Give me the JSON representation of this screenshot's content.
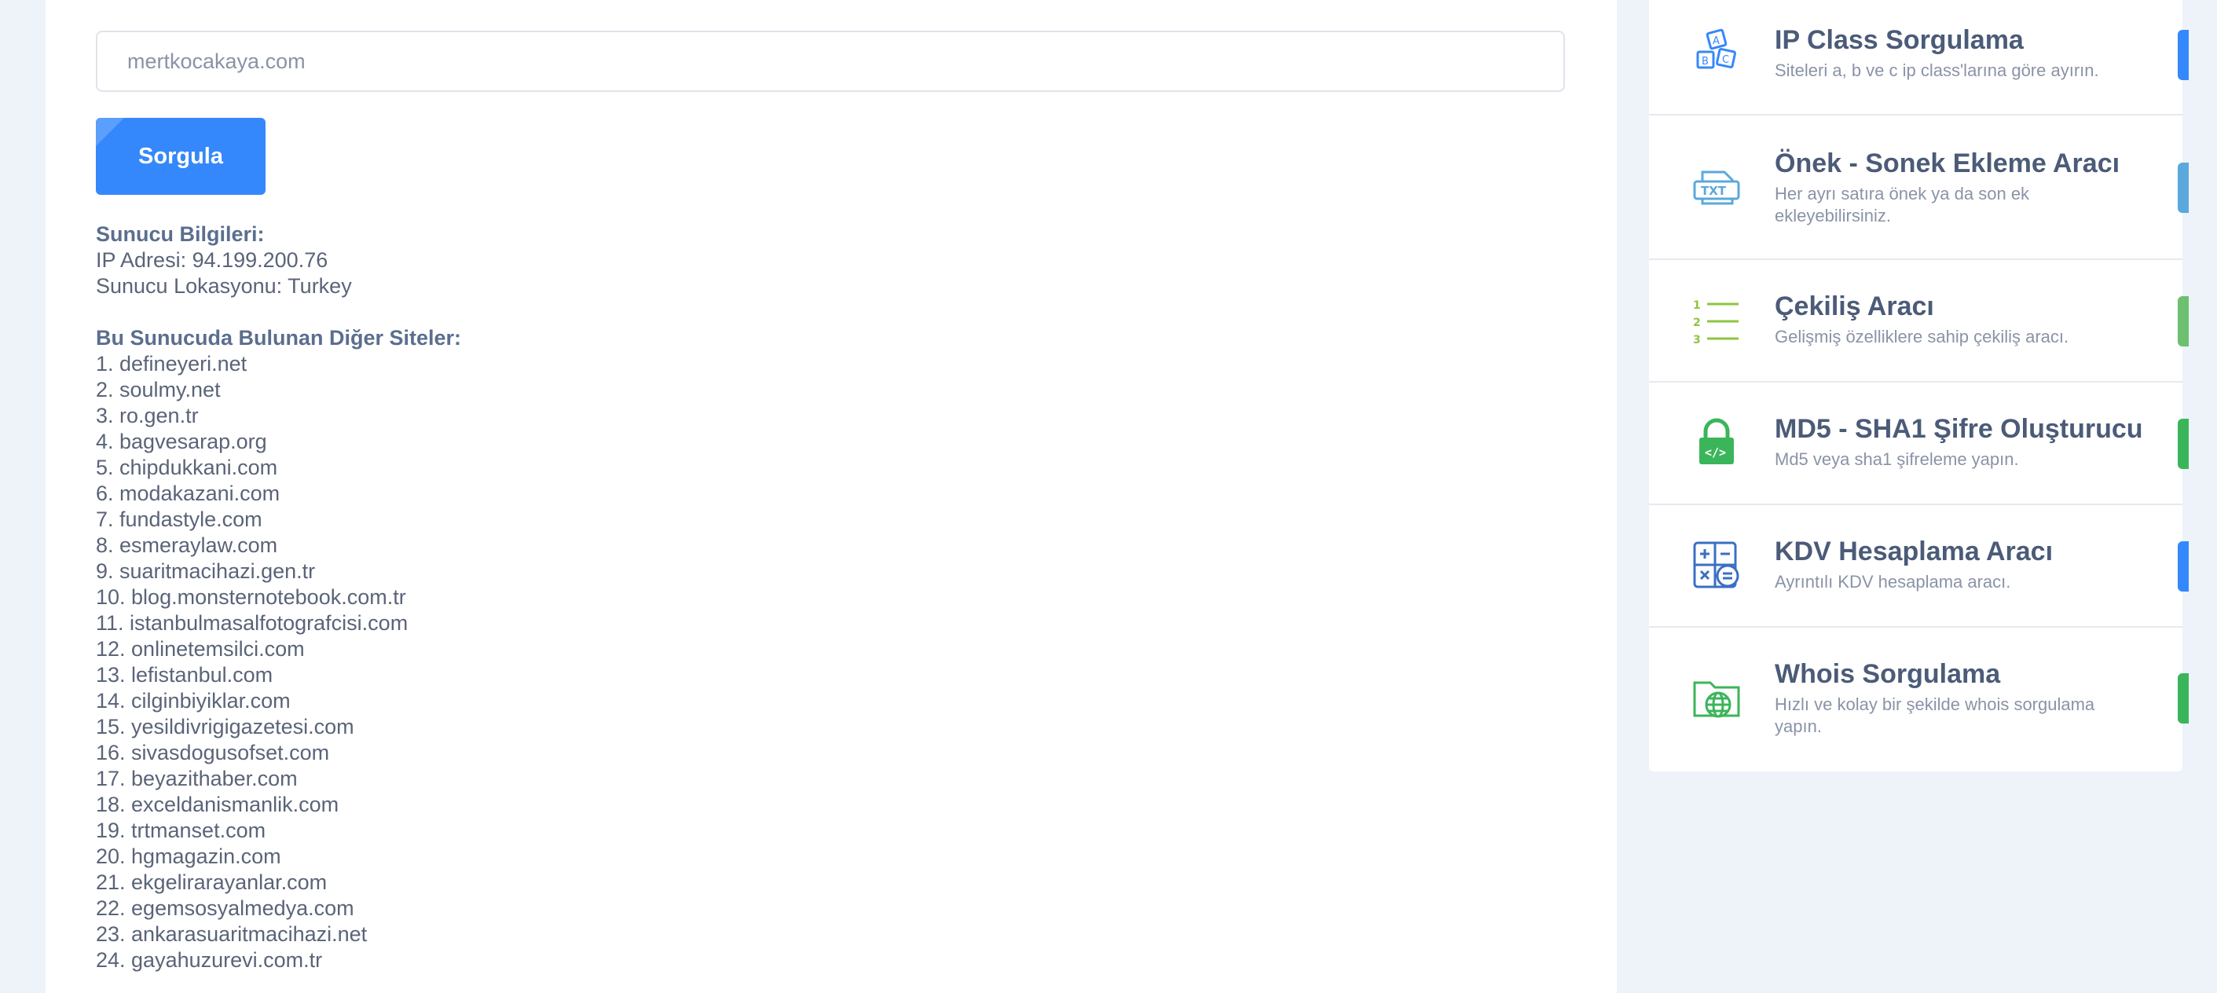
{
  "query": {
    "input_value": "mertkocakaya.com",
    "button_label": "Sorgula"
  },
  "server_info": {
    "heading": "Sunucu Bilgileri:",
    "ip_line": "IP Adresi: 94.199.200.76",
    "location_line": "Sunucu Lokasyonu: Turkey"
  },
  "other_sites": {
    "heading": "Bu Sunucuda Bulunan Diğer Siteler:",
    "items": [
      "1. defineyeri.net",
      "2. soulmy.net",
      "3. ro.gen.tr",
      "4. bagvesarap.org",
      "5. chipdukkani.com",
      "6. modakazani.com",
      "7. fundastyle.com",
      "8. esmeraylaw.com",
      "9. suaritmacihazi.gen.tr",
      "10. blog.monsternotebook.com.tr",
      "11. istanbulmasalfotografcisi.com",
      "12. onlinetemsilci.com",
      "13. lefistanbul.com",
      "14. cilginbiyiklar.com",
      "15. yesildivrigigazetesi.com",
      "16. sivasdogusofset.com",
      "17. beyazithaber.com",
      "18. exceldanismanlik.com",
      "19. trtmanset.com",
      "20. hgmagazin.com",
      "21. ekgelirarayanlar.com",
      "22. egemsosyalmedya.com",
      "23. ankarasuaritmacihazi.net",
      "24. gayahuzurevi.com.tr"
    ]
  },
  "sidebar": {
    "tools": [
      {
        "title": "IP Class Sorgulama",
        "desc": "Siteleri a, b ve c ip class'larına göre ayırın.",
        "icon": "abc-blocks-icon",
        "color": "#3588fb"
      },
      {
        "title": "Önek - Sonek Ekleme Aracı",
        "desc": "Her ayrı satıra önek ya da son ek ekleyebilirsiniz.",
        "icon": "txt-file-icon",
        "color": "#5aa8dc"
      },
      {
        "title": "Çekiliş Aracı",
        "desc": "Gelişmiş özelliklere sahip çekiliş aracı.",
        "icon": "numbered-list-icon",
        "color": "#6cc070"
      },
      {
        "title": "MD5 - SHA1 Şifre Oluşturucu",
        "desc": "Md5 veya sha1 şifreleme yapın.",
        "icon": "padlock-code-icon",
        "color": "#3bb55a"
      },
      {
        "title": "KDV Hesaplama Aracı",
        "desc": "Ayrıntılı KDV hesaplama aracı.",
        "icon": "calculator-icon",
        "color": "#3588fb"
      },
      {
        "title": "Whois Sorgulama",
        "desc": "Hızlı ve kolay bir şekilde whois sorgulama yapın.",
        "icon": "globe-folder-icon",
        "color": "#3bb55a"
      }
    ]
  }
}
